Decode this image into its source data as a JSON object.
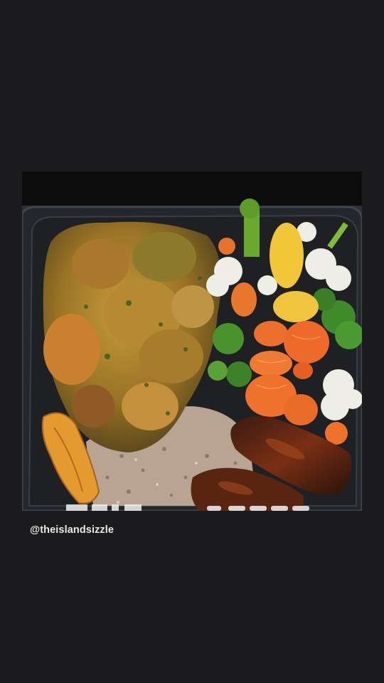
{
  "story": {
    "caption": "@theislandsizzle",
    "photo_alt": "takeout-food-photo"
  },
  "colors": {
    "background": "#1b1b1d",
    "caption_text": "#e9e9e9"
  }
}
